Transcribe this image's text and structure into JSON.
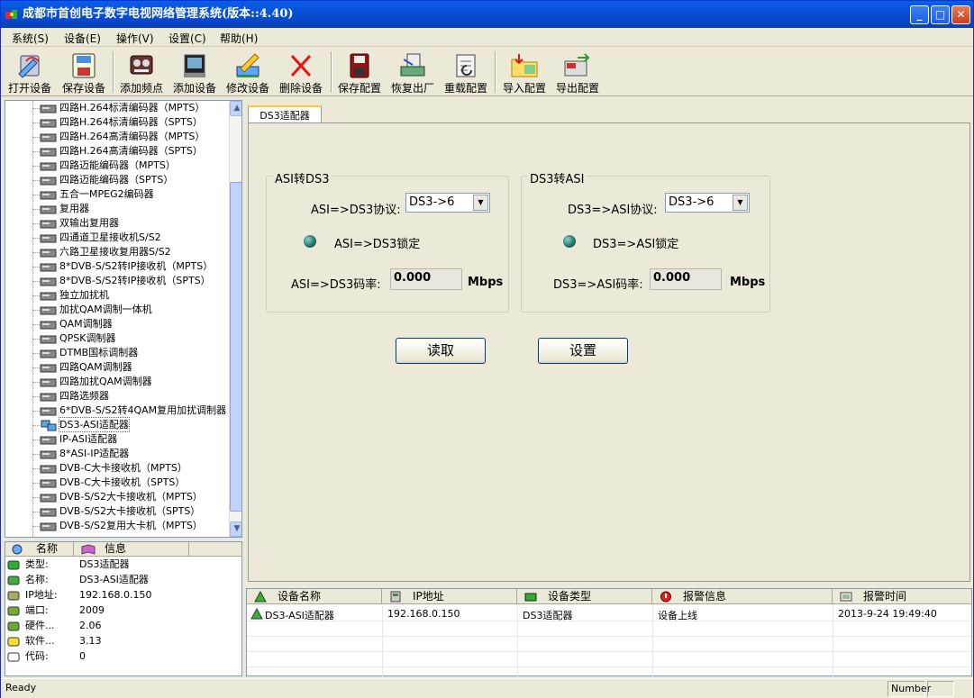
{
  "window": {
    "title": "成都市首创电子数字电视网络管理系统(版本::4.40)",
    "minimize": "_",
    "maximize": "□",
    "close": "✕"
  },
  "menu": [
    {
      "label": "系统(S)"
    },
    {
      "label": "设备(E)"
    },
    {
      "label": "操作(V)"
    },
    {
      "label": "设置(C)"
    },
    {
      "label": "帮助(H)"
    }
  ],
  "toolbar": [
    {
      "label": "打开设备",
      "icon": "open-device-icon"
    },
    {
      "label": "保存设备",
      "icon": "save-device-icon"
    },
    {
      "label": "添加频点",
      "icon": "add-frequency-icon"
    },
    {
      "label": "添加设备",
      "icon": "add-device-icon"
    },
    {
      "label": "修改设备",
      "icon": "edit-device-icon"
    },
    {
      "label": "删除设备",
      "icon": "delete-device-icon"
    },
    {
      "label": "保存配置",
      "icon": "save-config-icon"
    },
    {
      "label": "恢复出厂",
      "icon": "factory-reset-icon"
    },
    {
      "label": "重载配置",
      "icon": "reload-config-icon"
    },
    {
      "label": "导入配置",
      "icon": "import-config-icon"
    },
    {
      "label": "导出配置",
      "icon": "export-config-icon"
    }
  ],
  "tree": {
    "items": [
      "四路H.264标清编码器（MPTS）",
      "四路H.264标清编码器（SPTS）",
      "四路H.264高清编码器（MPTS）",
      "四路H.264高清编码器（SPTS）",
      "四路迈能编码器（MPTS）",
      "四路迈能编码器（SPTS）",
      "五合一MPEG2编码器",
      "复用器",
      "双输出复用器",
      "四通道卫星接收机S/S2",
      "六路卫星接收复用器S/S2",
      "8*DVB-S/S2转IP接收机（MPTS）",
      "8*DVB-S/S2转IP接收机（SPTS）",
      "独立加扰机",
      "加扰QAM调制一体机",
      "QAM调制器",
      "QPSK调制器",
      "DTMB国标调制器",
      "四路QAM调制器",
      "四路加扰QAM调制器",
      "四路选频器",
      "6*DVB-S/S2转4QAM复用加扰调制器",
      "DS3-ASI适配器",
      "IP-ASI适配器",
      "8*ASI-IP适配器",
      "DVB-C大卡接收机（MPTS）",
      "DVB-C大卡接收机（SPTS）",
      "DVB-S/S2大卡接收机（MPTS）",
      "DVB-S/S2大卡接收机（SPTS）",
      "DVB-S/S2复用大卡机（MPTS）"
    ],
    "selected_index": 22
  },
  "info": {
    "col_name": "名称",
    "col_info": "信息",
    "rows": [
      {
        "key": "类型:",
        "value": "DS3适配器"
      },
      {
        "key": "名称:",
        "value": "DS3-ASI适配器"
      },
      {
        "key": "IP地址:",
        "value": "192.168.0.150"
      },
      {
        "key": "端口:",
        "value": "2009"
      },
      {
        "key": "硬件...",
        "value": "2.06"
      },
      {
        "key": "软件...",
        "value": "3.13"
      },
      {
        "key": "代码:",
        "value": "0"
      }
    ]
  },
  "tab": {
    "label": "DS3适配器"
  },
  "asi_to_ds3": {
    "title": "ASI转DS3",
    "protocol_label": "ASI=>DS3协议:",
    "protocol_value": "DS3->6",
    "lock_label": "ASI=>DS3锁定",
    "rate_label": "ASI=>DS3码率:",
    "rate_value": "0.000",
    "unit": "Mbps"
  },
  "ds3_to_asi": {
    "title": "DS3转ASI",
    "protocol_label": "DS3=>ASI协议:",
    "protocol_value": "DS3->6",
    "lock_label": "DS3=>ASI锁定",
    "rate_label": "DS3=>ASI码率:",
    "rate_value": "0.000",
    "unit": "Mbps"
  },
  "buttons": {
    "read": "读取",
    "set": "设置"
  },
  "alarm": {
    "headers": [
      "设备名称",
      "IP地址",
      "设备类型",
      "报警信息",
      "报警时间"
    ],
    "rows": [
      {
        "device": "DS3-ASI适配器",
        "ip": "192.168.0.150",
        "type": "DS3适配器",
        "info": "设备上线",
        "time": "2013-9-24 19:49:40"
      }
    ]
  },
  "status": {
    "ready": "Ready",
    "number": "Number"
  },
  "colors": {
    "titlebar": "#0852d8",
    "led": "#1c6e66",
    "panel_bg": "#ece9d8"
  }
}
